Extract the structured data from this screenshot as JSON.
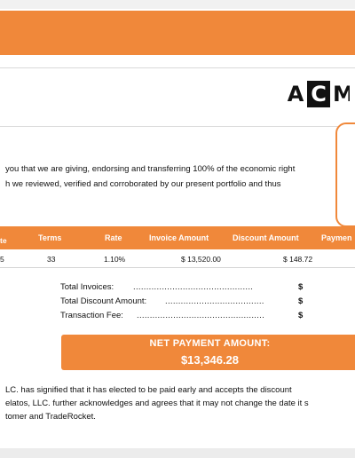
{
  "brand": {
    "logo_letters": [
      "A",
      "C",
      "M"
    ],
    "accent_color": "#f0883a"
  },
  "intro": {
    "lines": [
      "you that we are giving, endorsing and transferring 100% of the economic right",
      "h we reviewed, verified and corroborated by our present portfolio and thus"
    ]
  },
  "table": {
    "headers": {
      "date_line1": "",
      "date_line2": "te",
      "terms": "Terms",
      "rate": "Rate",
      "invoice_amount": "Invoice Amount",
      "discount_amount": "Discount Amount",
      "payment": "Paymen"
    },
    "rows": [
      {
        "date": "5",
        "terms": "33",
        "rate": "1.10%",
        "invoice_amount": "$ 13,520.00",
        "discount_amount": "$ 148.72"
      }
    ]
  },
  "totals": {
    "total_invoices_label": "Total Invoices:",
    "total_invoices_dots": "..............................................",
    "total_invoices_currency": "$",
    "total_discount_label": "Total Discount Amount:",
    "total_discount_dots": "......................................",
    "total_discount_currency": "$",
    "transaction_fee_label": "Transaction Fee:",
    "transaction_fee_dots": ".................................................",
    "transaction_fee_currency": "$"
  },
  "net_payment": {
    "label": "NET PAYMENT AMOUNT:",
    "value": "$13,346.28"
  },
  "footer": {
    "lines": [
      "LC. has signified that it has elected to be paid early and accepts the discount",
      "elatos, LLC. further acknowledges and agrees that it may not change the date it s",
      "tomer and TradeRocket."
    ]
  }
}
